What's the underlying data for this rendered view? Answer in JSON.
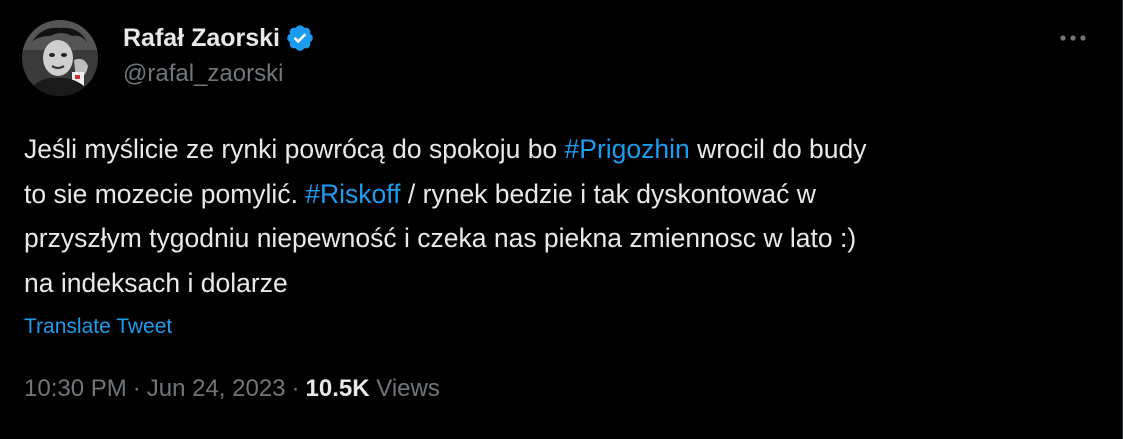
{
  "author": {
    "display_name": "Rafał Zaorski",
    "handle": "@rafal_zaorski",
    "verified_icon": "verified-badge-icon",
    "avatar_icon": "avatar"
  },
  "menu": {
    "more_icon": "more-horizontal-icon"
  },
  "tweet": {
    "segments": [
      {
        "text": "Jeśli myślicie ze rynki powrócą do spokoju bo ",
        "type": "text"
      },
      {
        "text": "#Prigozhin",
        "type": "hashtag"
      },
      {
        "text": " wrocil do budy\nto sie mozecie pomylić. ",
        "type": "text"
      },
      {
        "text": "#Riskoff",
        "type": "hashtag"
      },
      {
        "text": " / rynek bedzie i tak dyskontować w\nprzyszłym tygodniu niepewność i czeka nas piekna zmiennosc w lato :)\nna indeksach i dolarze",
        "type": "text"
      }
    ],
    "translate_label": "Translate Tweet"
  },
  "meta": {
    "time": "10:30 PM",
    "dot1": "·",
    "date": "Jun 24, 2023",
    "dot2": "·",
    "views_count": "10.5K",
    "views_label": "Views"
  },
  "colors": {
    "background": "#000000",
    "text_primary": "#e7e9ea",
    "text_secondary": "#71767b",
    "accent": "#1d9bf0"
  }
}
